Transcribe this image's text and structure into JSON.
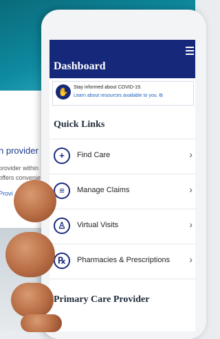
{
  "background_card": {
    "heading": "n provider",
    "line1": "provider within",
    "line2": "offers convenie",
    "link": "Provi"
  },
  "app": {
    "title": "Dashboard",
    "alert": {
      "line1": "Stay informed about COVID-19.",
      "line2": "Learn about resources available to you.",
      "link_icon": "external-link-icon"
    },
    "quick_links_title": "Quick Links",
    "quick_links": [
      {
        "label": "Find Care",
        "icon": "plus-icon"
      },
      {
        "label": "Manage Claims",
        "icon": "document-icon"
      },
      {
        "label": "Virtual Visits",
        "icon": "doctor-icon"
      },
      {
        "label": "Pharmacies & Prescriptions",
        "icon": "prescription-icon"
      }
    ],
    "primary_care_title": "Primary Care Provider"
  },
  "colors": {
    "brand": "#16287a",
    "link": "#1b5fbf"
  }
}
